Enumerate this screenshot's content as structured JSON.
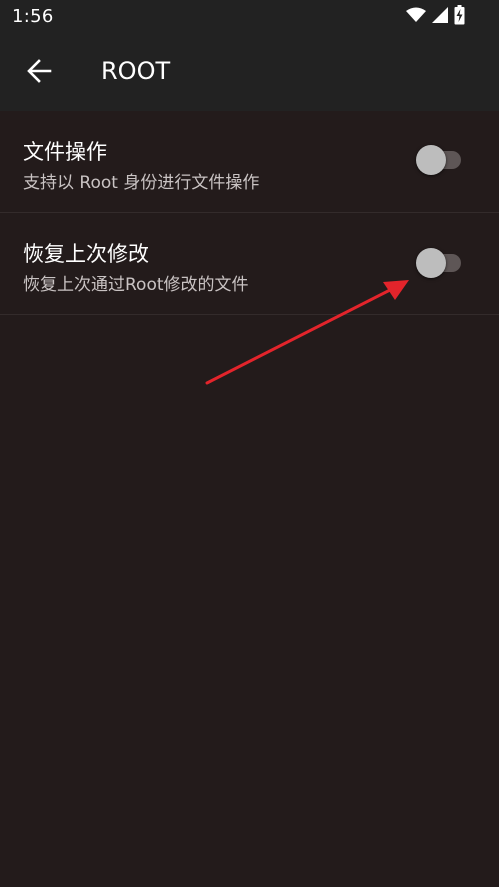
{
  "status_bar": {
    "time": "1:56",
    "icons": [
      "wifi-icon",
      "cellular-signal-icon",
      "battery-charging-icon"
    ]
  },
  "toolbar": {
    "title": "ROOT",
    "back_icon": "arrow-back-icon"
  },
  "settings": [
    {
      "title": "文件操作",
      "summary": "支持以 Root 身份进行文件操作",
      "enabled": false
    },
    {
      "title": "恢复上次修改",
      "summary": "恢复上次通过Root修改的文件",
      "enabled": false
    }
  ],
  "colors": {
    "background": "#231b1b",
    "toolbar": "#222222",
    "annotation_arrow": "#e3242b",
    "switch_thumb_off": "#bdbdbd",
    "switch_track_off": "#5e5656"
  }
}
